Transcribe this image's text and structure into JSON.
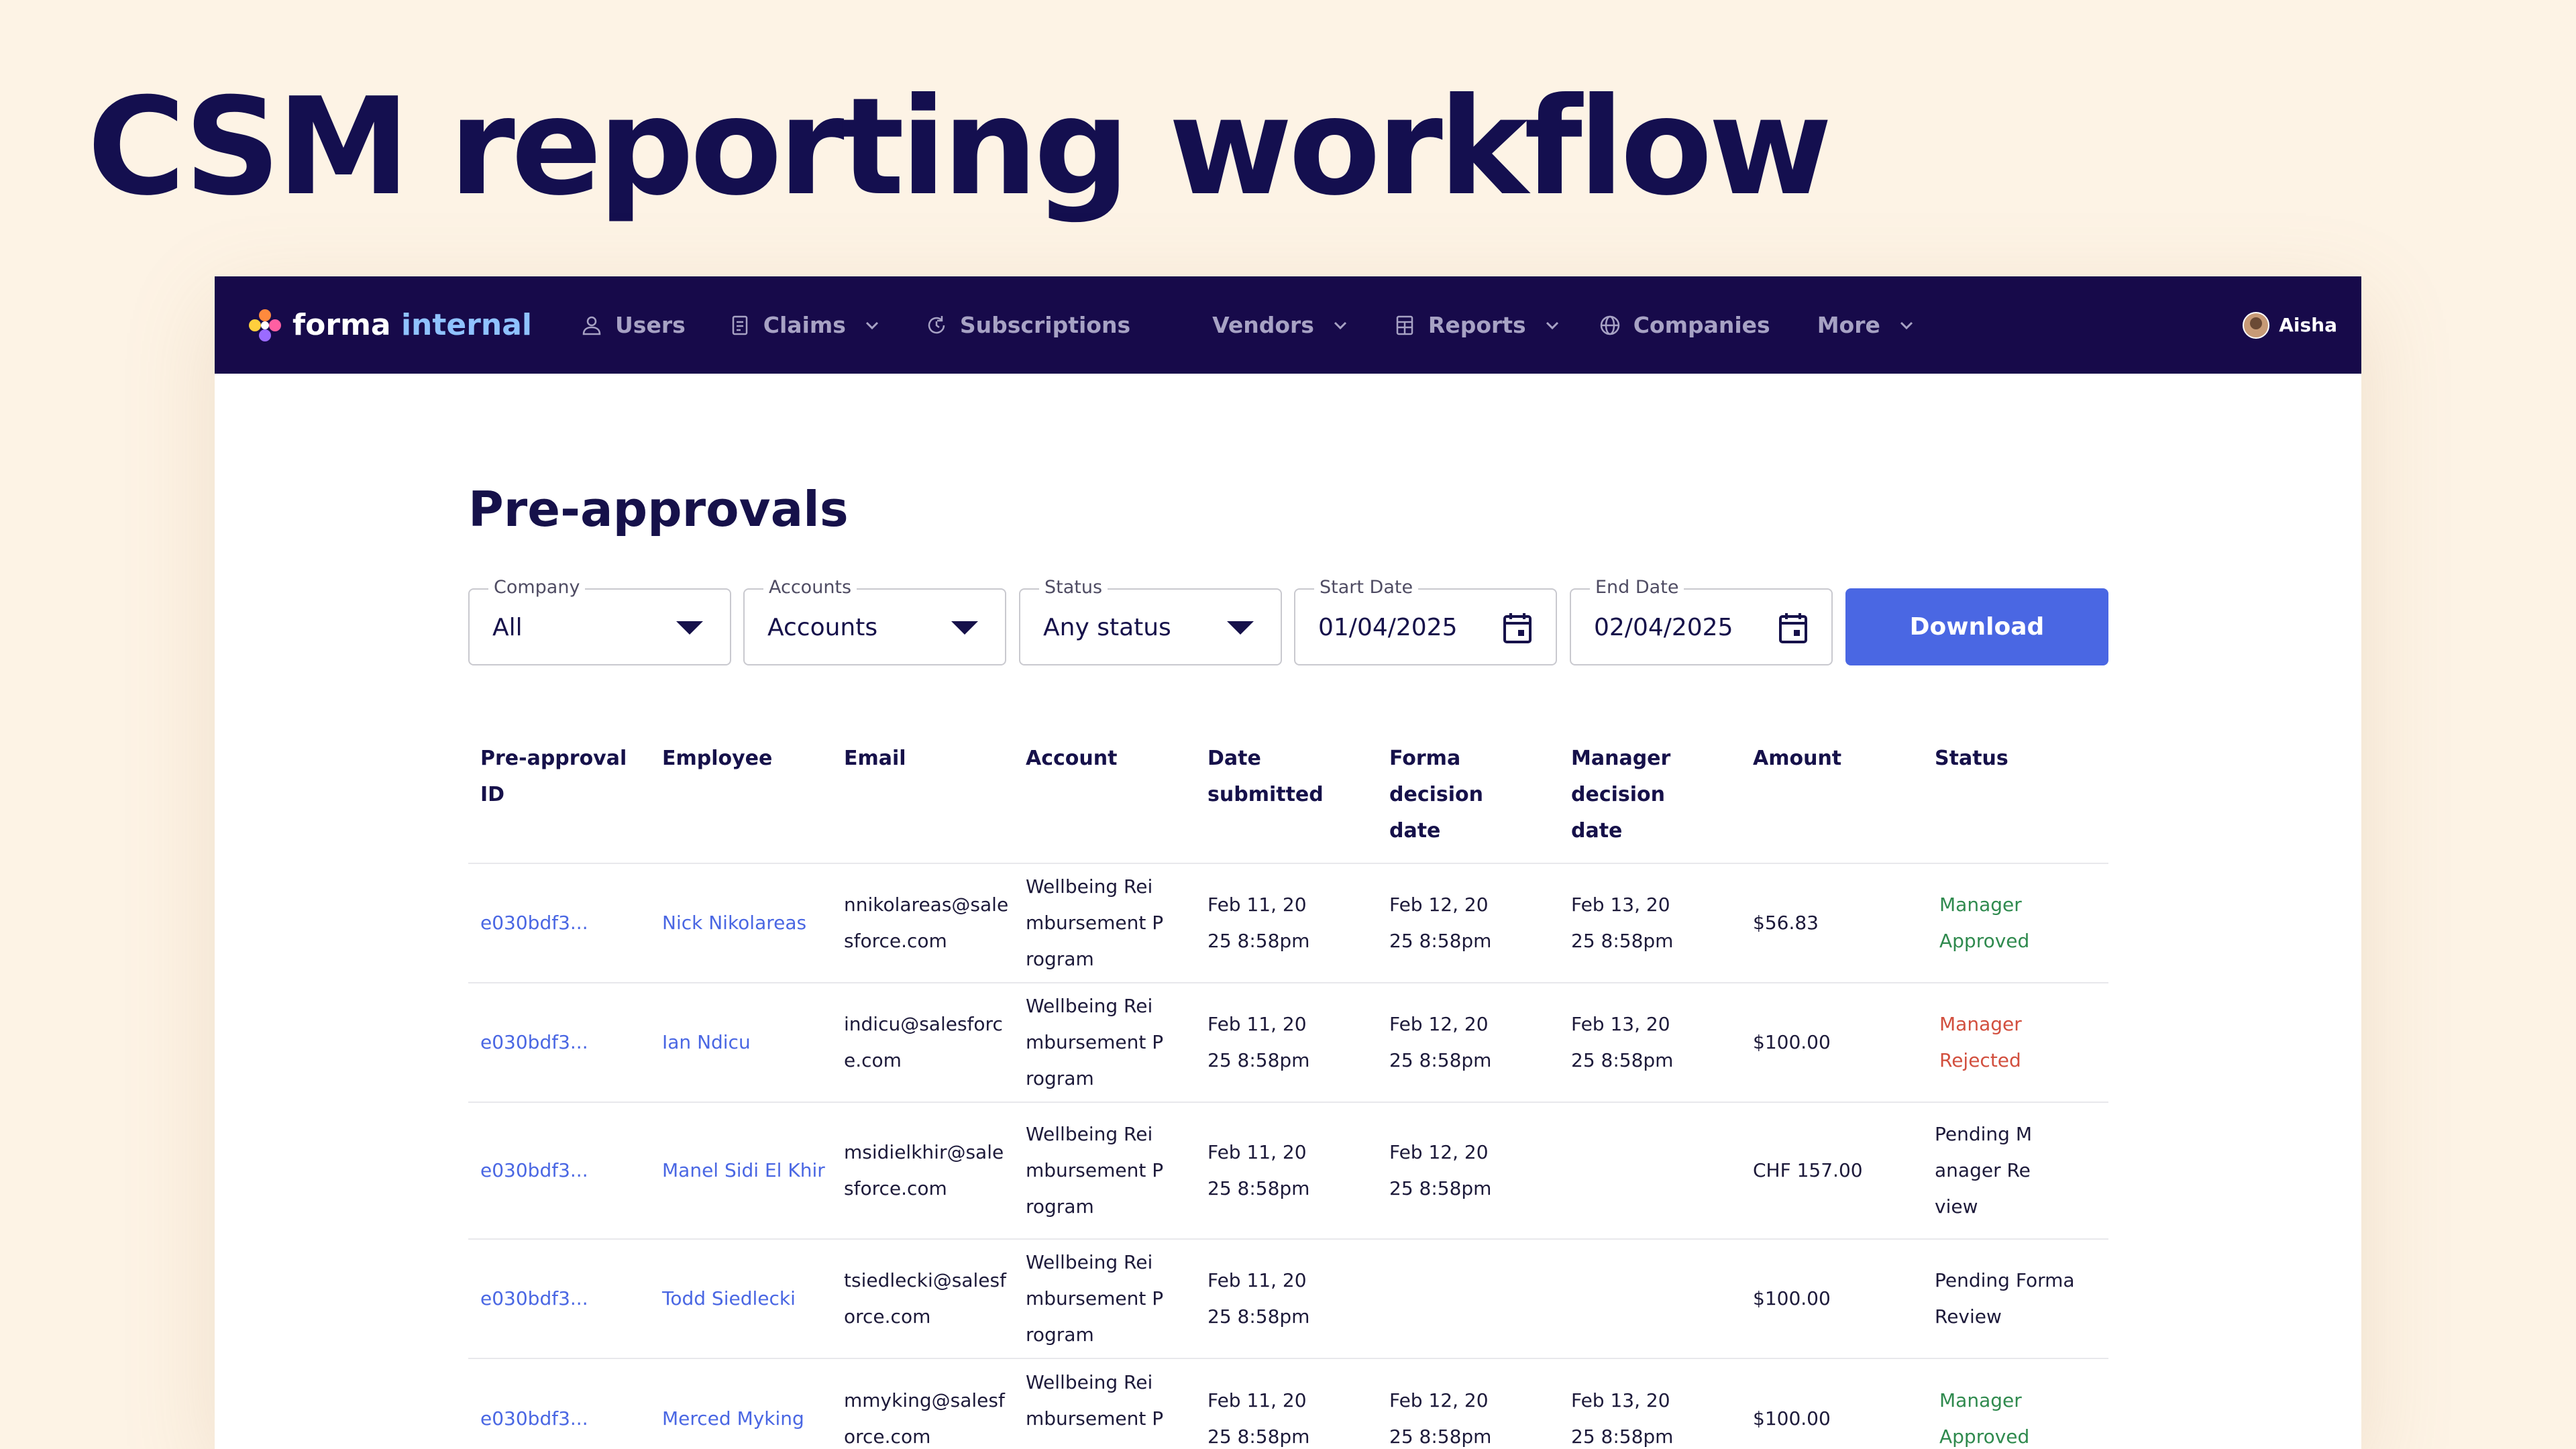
{
  "slide_title": "CSM reporting workflow",
  "nav": {
    "logo_word": "forma",
    "logo_accent": "internal",
    "items": [
      {
        "label": "Users",
        "icon": "user-icon"
      },
      {
        "label": "Claims",
        "icon": "document-icon"
      },
      {
        "label": "Subscriptions",
        "icon": "refresh-icon"
      },
      {
        "label": "Vendors"
      },
      {
        "label": "Reports",
        "icon": "table-icon"
      },
      {
        "label": "Companies",
        "icon": "globe-icon"
      },
      {
        "label": "More"
      }
    ],
    "user_name": "Aisha"
  },
  "page_title": "Pre-approvals",
  "filters": {
    "company": {
      "label": "Company",
      "value": "All"
    },
    "accounts": {
      "label": "Accounts",
      "value": "Accounts"
    },
    "status": {
      "label": "Status",
      "value": "Any status"
    },
    "start_date": {
      "label": "Start Date",
      "value": "01/04/2025"
    },
    "end_date": {
      "label": "End Date",
      "value": "02/04/2025"
    },
    "download_label": "Download"
  },
  "table": {
    "columns": [
      "Pre-approval ID",
      "Employee",
      "Email",
      "Account",
      "Date submitted",
      "Forma decision date",
      "Manager decision date",
      "Amount",
      "Status"
    ],
    "rows": [
      {
        "id": "e030bdf3...",
        "employee": "Nick Nikolareas",
        "email": "nnikolareas@salesforce.com",
        "account": "Wellbeing Reimbursement Program",
        "submitted": "Feb 11, 2025 8:58pm",
        "forma_decision": "Feb 12, 2025 8:58pm",
        "manager_decision": "Feb 13, 2025 8:58pm",
        "amount": "$56.83",
        "status": "Manager Approved"
      },
      {
        "id": "e030bdf3...",
        "employee": "Ian Ndicu",
        "email": "indicu@salesforce.com",
        "account": "Wellbeing Reimbursement Program",
        "submitted": "Feb 11, 2025 8:58pm",
        "forma_decision": "Feb 12, 2025 8:58pm",
        "manager_decision": "Feb 13, 2025 8:58pm",
        "amount": "$100.00",
        "status": "Manager Rejected"
      },
      {
        "id": "e030bdf3...",
        "employee": "Manel Sidi El Khir",
        "email": "msidielkhir@salesforce.com",
        "account": "Wellbeing Reimbursement Program",
        "submitted": "Feb 11, 2025 8:58pm",
        "forma_decision": "Feb 12, 2025 8:58pm",
        "manager_decision": "",
        "amount": "CHF 157.00",
        "status": "Pending Manager Review"
      },
      {
        "id": "e030bdf3...",
        "employee": "Todd Siedlecki",
        "email": "tsiedlecki@salesforce.com",
        "account": "Wellbeing Reimbursement Program",
        "submitted": "Feb 11, 2025 8:58pm",
        "forma_decision": "",
        "manager_decision": "",
        "amount": "$100.00",
        "status": "Pending Forma Review"
      },
      {
        "id": "e030bdf3...",
        "employee": "Merced Myking",
        "email": "mmyking@salesforce.com",
        "account": "Wellbeing Reimbursement Program",
        "submitted": "Feb 11, 2025 8:58pm",
        "forma_decision": "Feb 12, 2025 8:58pm",
        "manager_decision": "Feb 13, 2025 8:58pm",
        "amount": "$100.00",
        "status": "Manager Approved"
      }
    ]
  },
  "colors": {
    "nav_bg": "#170a4a",
    "accent": "#4a67e3",
    "approved": "#2f8a4e",
    "rejected": "#d24f3e",
    "slide_bg": "#fdf3e5"
  }
}
